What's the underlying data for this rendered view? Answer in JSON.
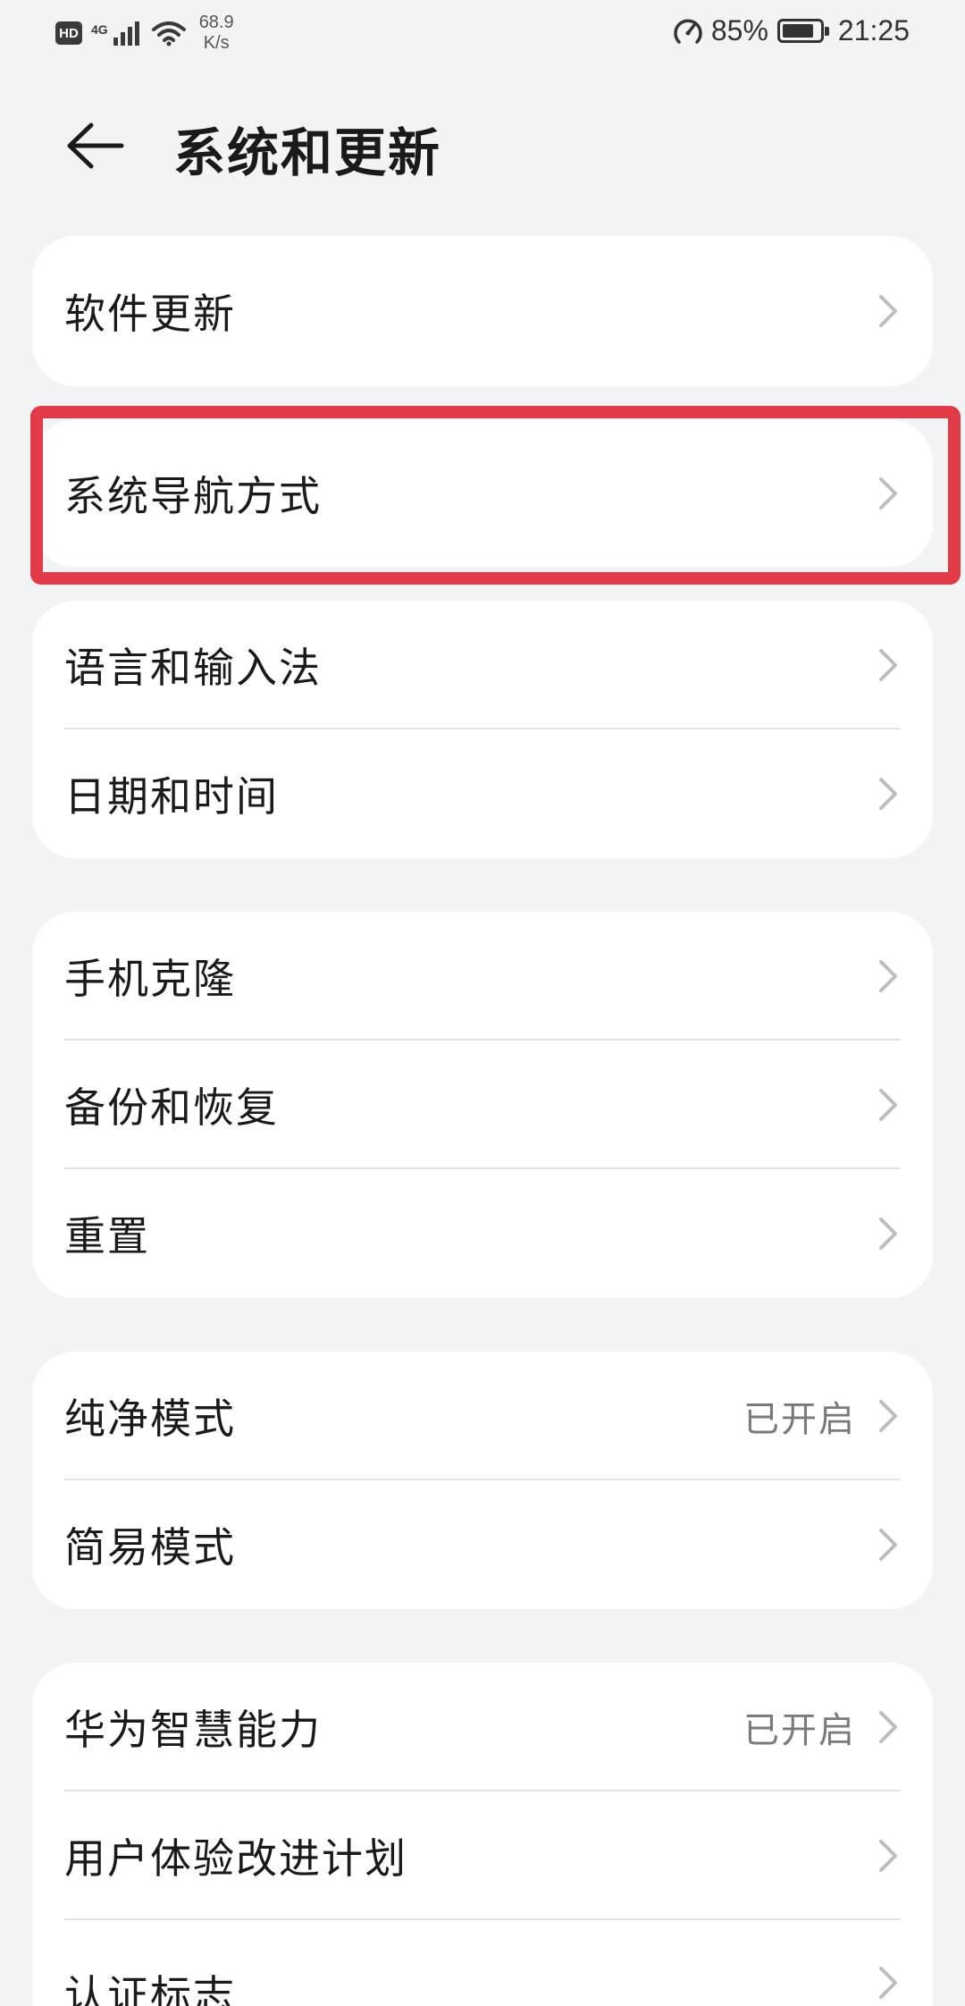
{
  "status_bar": {
    "hd_badge": "HD",
    "network_type": "4G",
    "speed_value": "68.9",
    "speed_unit": "K/s",
    "battery_percent": "85%",
    "battery_level": 0.85,
    "time": "21:25",
    "icons": [
      "hd-icon",
      "cellular-signal-icon",
      "wifi-icon",
      "data-saver-icon",
      "battery-icon"
    ]
  },
  "header": {
    "back_icon": "back-arrow-icon",
    "title": "系统和更新"
  },
  "groups": [
    {
      "items": [
        {
          "label": "软件更新"
        }
      ]
    },
    {
      "items": [
        {
          "label": "系统导航方式"
        }
      ]
    },
    {
      "items": [
        {
          "label": "语言和输入法"
        },
        {
          "label": "日期和时间"
        }
      ]
    },
    {
      "items": [
        {
          "label": "手机克隆"
        },
        {
          "label": "备份和恢复"
        },
        {
          "label": "重置"
        }
      ]
    },
    {
      "items": [
        {
          "label": "纯净模式",
          "value": "已开启"
        },
        {
          "label": "简易模式"
        }
      ]
    },
    {
      "items": [
        {
          "label": "华为智慧能力",
          "value": "已开启"
        },
        {
          "label": "用户体验改进计划"
        },
        {
          "label": "认证标志"
        }
      ]
    }
  ],
  "colors": {
    "background": "#f1f3f5",
    "card": "#ffffff",
    "highlight": "#e23a47",
    "text_primary": "#1a1a1a",
    "text_secondary": "#7a7a7a",
    "chevron": "#bdbdbd"
  }
}
